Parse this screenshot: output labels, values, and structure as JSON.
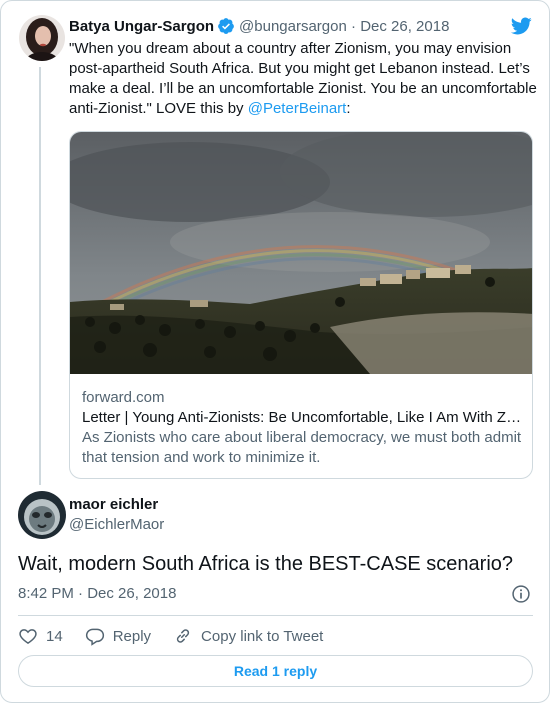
{
  "quoted_tweet": {
    "author_name": "Batya Ungar-Sargon",
    "handle": "@bungarsargon",
    "separator": " · ",
    "date": "Dec 26, 2018",
    "text_before_mention": "\"When you dream about a country after Zionism, you may envision post-apartheid South Africa. But you might get Lebanon instead. Let’s make a deal. I’ll be an uncomfortable Zionist. You be an uncomfortable anti-Zionist.\" LOVE this by ",
    "mention": "@PeterBeinart",
    "text_after_mention": ":",
    "link_card": {
      "domain": "forward.com",
      "title": "Letter | Young Anti-Zionists: Be Uncomfortable, Like I Am With Zionism",
      "description": "As Zionists who care about liberal democracy, we must both admit that tension and work to minimize it."
    }
  },
  "reply_tweet": {
    "author_name": "maor eichler",
    "handle": "@EichlerMaor",
    "text": "Wait, modern South Africa is the BEST-CASE scenario?",
    "time": "8:42 PM",
    "separator": " · ",
    "date": "Dec 26, 2018"
  },
  "actions": {
    "like_count": "14",
    "reply_label": "Reply",
    "copy_link_label": "Copy link to Tweet"
  },
  "read_reply_label": "Read 1 reply",
  "colors": {
    "accent": "#1d9bf0",
    "muted": "#536471",
    "border": "#cfd9de",
    "text": "#0f1419"
  },
  "icons": {
    "brand": "twitter-bird-icon",
    "verified": "verified-badge-icon",
    "info": "info-icon",
    "like": "heart-icon",
    "reply": "reply-bubble-icon",
    "copy_link": "link-icon"
  }
}
